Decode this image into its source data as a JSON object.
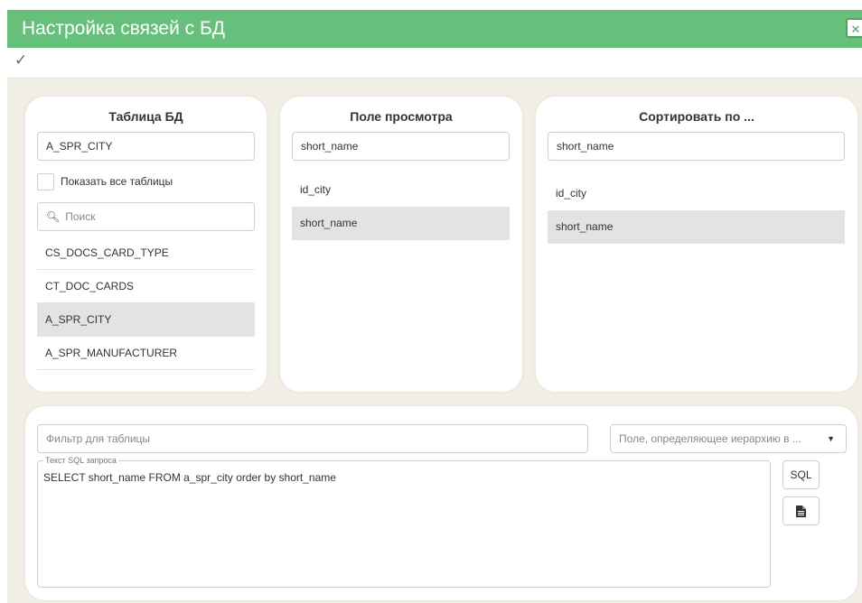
{
  "window": {
    "title": "Настройка связей с БД",
    "close_icon": "excel-export-icon",
    "accent_color": "#66bf7a",
    "background_color": "#f2f0e6"
  },
  "toolbar": {
    "confirm_icon": "check-icon"
  },
  "tables_panel": {
    "title": "Таблица БД",
    "selected_table": "A_SPR_CITY",
    "show_all_label": "Показать все таблицы",
    "show_all_checked": false,
    "search_placeholder": "Поиск",
    "items": [
      {
        "label": "CS_DOCS_CARD_TYPE",
        "selected": false
      },
      {
        "label": "CT_DOC_CARDS",
        "selected": false
      },
      {
        "label": "A_SPR_CITY",
        "selected": true
      },
      {
        "label": "A_SPR_MANUFACTURER",
        "selected": false
      }
    ]
  },
  "view_field_panel": {
    "title": "Поле просмотра",
    "selected_field": "short_name",
    "items": [
      {
        "label": "id_city",
        "selected": false
      },
      {
        "label": "short_name",
        "selected": true
      }
    ]
  },
  "sort_panel": {
    "title": "Сортировать по ...",
    "selected_field": "short_name",
    "items": [
      {
        "label": "id_city",
        "selected": false
      },
      {
        "label": "short_name",
        "selected": true
      }
    ]
  },
  "query_panel": {
    "filter_placeholder": "Фильтр для таблицы",
    "hierarchy_placeholder": "Поле, определяющее иерархию в ...",
    "sql_legend": "Текст SQL запроса",
    "sql_text": "SELECT short_name FROM a_spr_city order by short_name",
    "sql_button_label": "SQL",
    "document_button_icon": "document-icon"
  }
}
